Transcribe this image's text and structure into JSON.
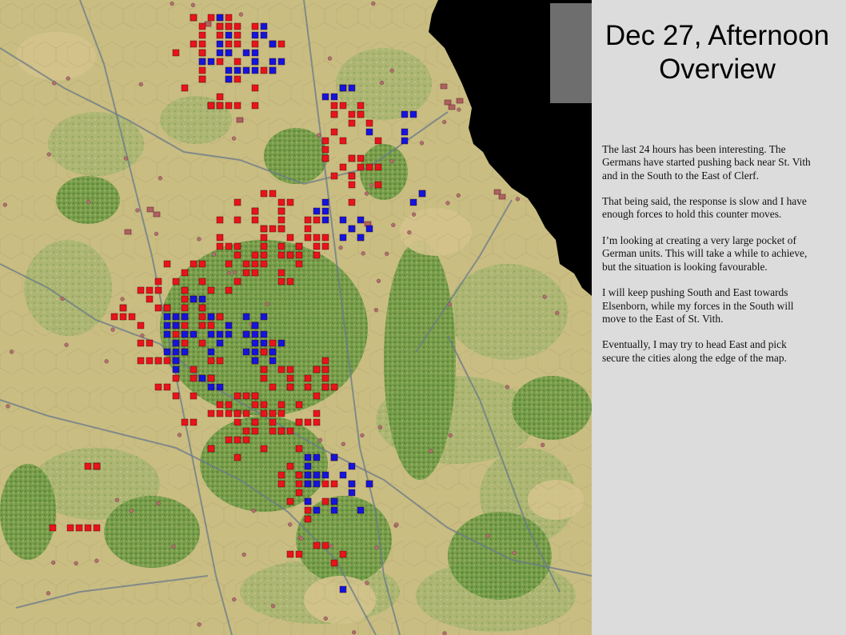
{
  "slide": {
    "title_line1": "Dec 27, Afternoon",
    "title_line2": "Overview",
    "paragraphs": [
      "The last 24 hours has been interesting.  The Germans have started pushing back near St. Vith and in the South to the East of Clerf.",
      "That being said, the response is slow and I have enough forces to hold this counter moves.",
      "I’m looking at creating a very large pocket of German units.  This will take a while to achieve, but the situation is looking favourable.",
      "I will keep pushing South and East towards Elsenborn, while my forces in the South will move to the East of St. Vith.",
      "Eventually, I may try to head East and pick secure the cities along the edge of the map."
    ]
  },
  "map": {
    "colors": {
      "background_terrain": "#c9bd82",
      "open_terrain": "#d4c38c",
      "forest": "#6f9a45",
      "light_woods": "#a6b66a",
      "road": "#6a7a88",
      "off_map": "#000000",
      "allied_unit": "#e8141b",
      "german_unit": "#1414dc",
      "town": "#b06060"
    },
    "unit_types": [
      "allied-unit",
      "german-unit"
    ]
  }
}
